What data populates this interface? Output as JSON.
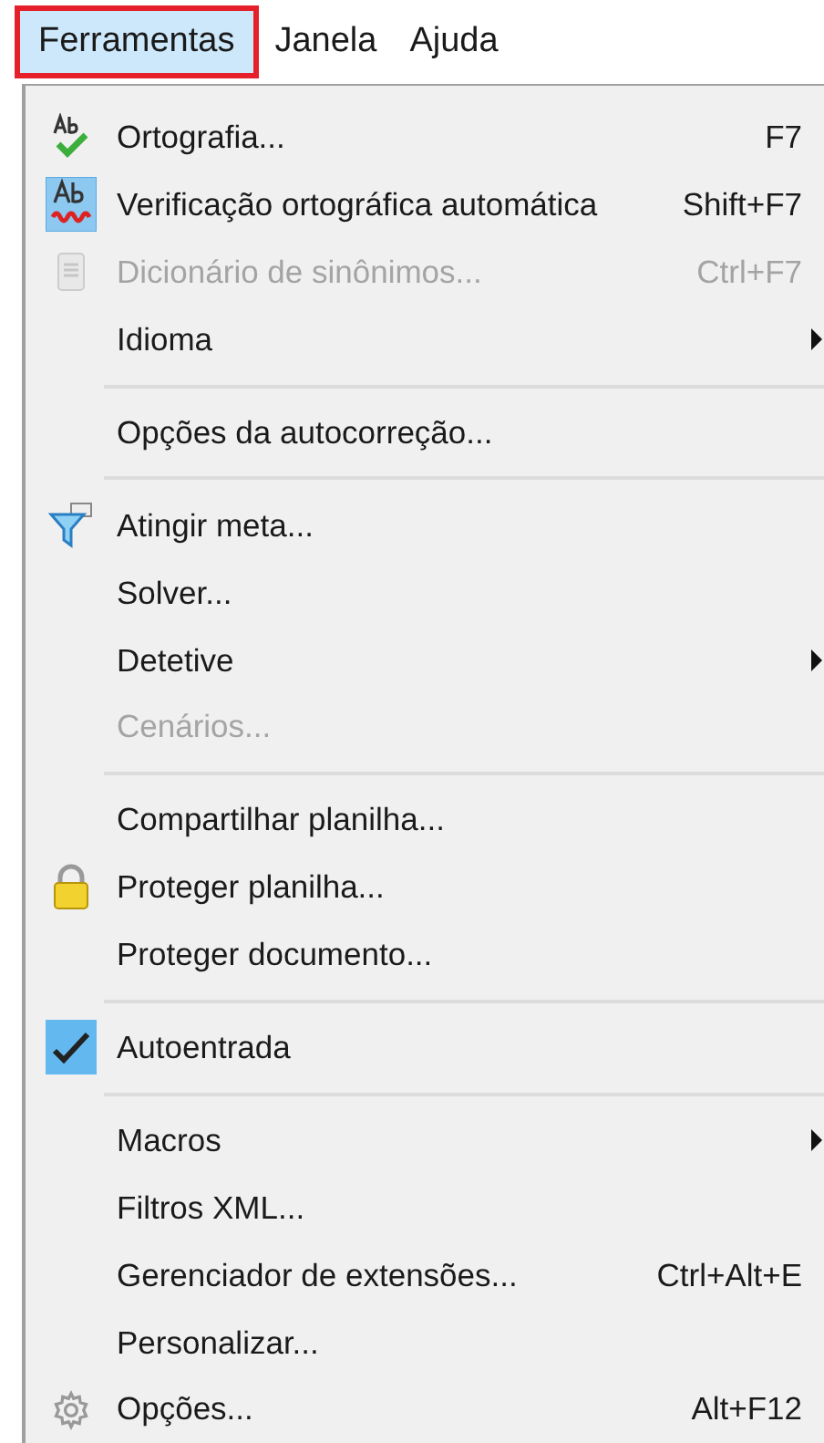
{
  "menubar": [
    {
      "label": "Ferramentas",
      "selected": true
    },
    {
      "label": "Janela",
      "selected": false
    },
    {
      "label": "Ajuda",
      "selected": false
    }
  ],
  "menu": [
    {
      "kind": "spellcheck",
      "label": "Ortografia...",
      "shortcut": "F7",
      "checked": false,
      "disabled": false,
      "submenu": false
    },
    {
      "kind": "spelltoggle",
      "label": "Verificação ortográfica automática",
      "shortcut": "Shift+F7",
      "checked": true,
      "disabled": false,
      "submenu": false
    },
    {
      "kind": "thesaurus",
      "label": "Dicionário de sinônimos...",
      "shortcut": "Ctrl+F7",
      "checked": false,
      "disabled": true,
      "submenu": false
    },
    {
      "kind": "item",
      "label": "Idioma",
      "checked": false,
      "disabled": false,
      "submenu": true
    },
    {
      "kind": "separator"
    },
    {
      "kind": "item",
      "label": "Opções da autocorreção...",
      "checked": false,
      "disabled": false,
      "submenu": false
    },
    {
      "kind": "separator"
    },
    {
      "kind": "funnel",
      "label": "Atingir meta...",
      "checked": false,
      "disabled": false,
      "submenu": false
    },
    {
      "kind": "item",
      "label": "Solver...",
      "checked": false,
      "disabled": false,
      "submenu": false
    },
    {
      "kind": "item",
      "label": "Detetive",
      "checked": false,
      "disabled": false,
      "submenu": true
    },
    {
      "kind": "item",
      "label": "Cenários...",
      "checked": false,
      "disabled": true,
      "submenu": false
    },
    {
      "kind": "separator"
    },
    {
      "kind": "item",
      "label": "Compartilhar planilha...",
      "checked": false,
      "disabled": false,
      "submenu": false
    },
    {
      "kind": "lock",
      "label": "Proteger planilha...",
      "checked": false,
      "disabled": false,
      "submenu": false
    },
    {
      "kind": "item",
      "label": "Proteger documento...",
      "checked": false,
      "disabled": false,
      "submenu": false
    },
    {
      "kind": "separator"
    },
    {
      "kind": "toggle",
      "label": "Autoentrada",
      "checked": true,
      "disabled": false,
      "submenu": false
    },
    {
      "kind": "separator"
    },
    {
      "kind": "item",
      "label": "Macros",
      "checked": false,
      "disabled": false,
      "submenu": true
    },
    {
      "kind": "item",
      "label": "Filtros XML...",
      "checked": false,
      "disabled": false,
      "submenu": false
    },
    {
      "kind": "item",
      "label": "Gerenciador de extensões...",
      "shortcut": "Ctrl+Alt+E",
      "checked": false,
      "disabled": false,
      "submenu": false
    },
    {
      "kind": "item",
      "label": "Personalizar...",
      "checked": false,
      "disabled": false,
      "submenu": false
    },
    {
      "kind": "gear",
      "label": "Opções...",
      "shortcut": "Alt+F12",
      "checked": false,
      "disabled": false,
      "submenu": false
    }
  ]
}
